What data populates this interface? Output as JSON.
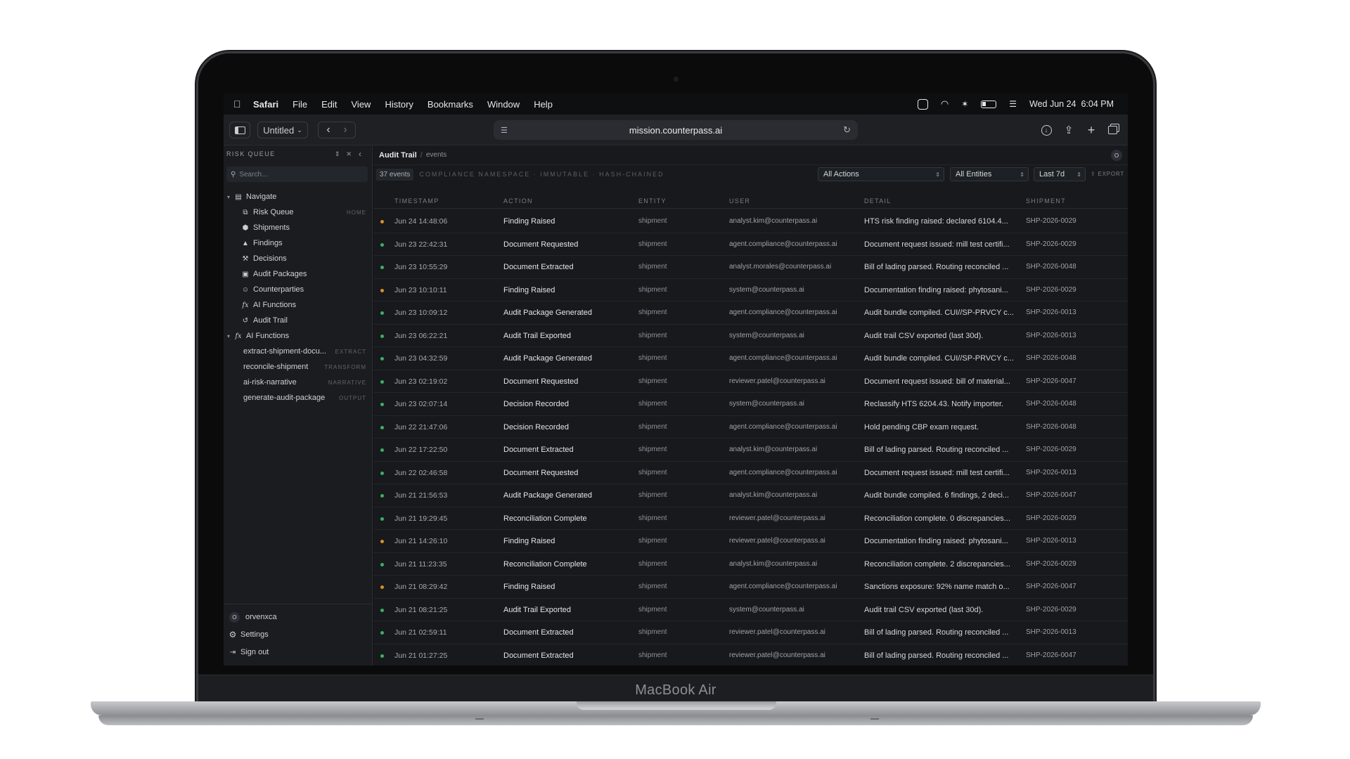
{
  "device": {
    "label": "MacBook Air"
  },
  "menubar": {
    "app": "Safari",
    "items": [
      "File",
      "Edit",
      "View",
      "History",
      "Bookmarks",
      "Window",
      "Help"
    ],
    "clock": "Wed Jun 24  6:04 PM"
  },
  "browser": {
    "tab_group": "Untitled",
    "url": "mission.counterpass.ai"
  },
  "sidebar": {
    "header": "RISK QUEUE",
    "search_placeholder": "Search...",
    "nav_group": "Navigate",
    "nav_items": [
      {
        "label": "Risk Queue",
        "badge": "HOME",
        "icon": "queue-icon"
      },
      {
        "label": "Shipments",
        "badge": "",
        "icon": "package-icon"
      },
      {
        "label": "Findings",
        "badge": "",
        "icon": "warning-icon"
      },
      {
        "label": "Decisions",
        "badge": "",
        "icon": "gavel-icon"
      },
      {
        "label": "Audit Packages",
        "badge": "",
        "icon": "archive-icon"
      },
      {
        "label": "Counterparties",
        "badge": "",
        "icon": "people-icon"
      },
      {
        "label": "AI Functions",
        "badge": "",
        "icon": "function-icon"
      },
      {
        "label": "Audit Trail",
        "badge": "",
        "icon": "history-icon"
      }
    ],
    "fn_group": "AI Functions",
    "fn_items": [
      {
        "label": "extract-shipment-docu...",
        "badge": "EXTRACT"
      },
      {
        "label": "reconcile-shipment",
        "badge": "TRANSFORM"
      },
      {
        "label": "ai-risk-narrative",
        "badge": "NARRATIVE"
      },
      {
        "label": "generate-audit-package",
        "badge": "OUTPUT"
      }
    ],
    "user_initial": "O",
    "user_name": "orvenxca",
    "settings": "Settings",
    "sign_out": "Sign out"
  },
  "header": {
    "title": "Audit Trail",
    "sep": "/",
    "sub": "events",
    "avatar": "O"
  },
  "filters": {
    "count": "37 events",
    "namespace": "COMPLIANCE NAMESPACE · IMMUTABLE · HASH-CHAINED",
    "actions": "All Actions",
    "entities": "All Entities",
    "range": "Last 7d",
    "export": "EXPORT"
  },
  "table": {
    "columns": [
      "TIMESTAMP",
      "ACTION",
      "ENTITY",
      "USER",
      "DETAIL",
      "SHIPMENT"
    ],
    "colors": {
      "warn": "#d8902a",
      "ok": "#3fae63"
    },
    "rows": [
      {
        "status": "warn",
        "ts": "Jun 24 14:48:06",
        "action": "Finding Raised",
        "entity": "shipment",
        "user": "analyst.kim@counterpass.ai",
        "detail": "HTS risk finding raised: declared 6104.4...",
        "shipment": "SHP-2026-0029"
      },
      {
        "status": "ok",
        "ts": "Jun 23 22:42:31",
        "action": "Document Requested",
        "entity": "shipment",
        "user": "agent.compliance@counterpass.ai",
        "detail": "Document request issued: mill test certifi...",
        "shipment": "SHP-2026-0029"
      },
      {
        "status": "ok",
        "ts": "Jun 23 10:55:29",
        "action": "Document Extracted",
        "entity": "shipment",
        "user": "analyst.morales@counterpass.ai",
        "detail": "Bill of lading parsed. Routing reconciled ...",
        "shipment": "SHP-2026-0048"
      },
      {
        "status": "warn",
        "ts": "Jun 23 10:10:11",
        "action": "Finding Raised",
        "entity": "shipment",
        "user": "system@counterpass.ai",
        "detail": "Documentation finding raised: phytosani...",
        "shipment": "SHP-2026-0029"
      },
      {
        "status": "ok",
        "ts": "Jun 23 10:09:12",
        "action": "Audit Package Generated",
        "entity": "shipment",
        "user": "agent.compliance@counterpass.ai",
        "detail": "Audit bundle compiled. CUI//SP-PRVCY c...",
        "shipment": "SHP-2026-0013"
      },
      {
        "status": "ok",
        "ts": "Jun 23 06:22:21",
        "action": "Audit Trail Exported",
        "entity": "shipment",
        "user": "system@counterpass.ai",
        "detail": "Audit trail CSV exported (last 30d).",
        "shipment": "SHP-2026-0013"
      },
      {
        "status": "ok",
        "ts": "Jun 23 04:32:59",
        "action": "Audit Package Generated",
        "entity": "shipment",
        "user": "agent.compliance@counterpass.ai",
        "detail": "Audit bundle compiled. CUI//SP-PRVCY c...",
        "shipment": "SHP-2026-0048"
      },
      {
        "status": "ok",
        "ts": "Jun 23 02:19:02",
        "action": "Document Requested",
        "entity": "shipment",
        "user": "reviewer.patel@counterpass.ai",
        "detail": "Document request issued: bill of material...",
        "shipment": "SHP-2026-0047"
      },
      {
        "status": "ok",
        "ts": "Jun 23 02:07:14",
        "action": "Decision Recorded",
        "entity": "shipment",
        "user": "system@counterpass.ai",
        "detail": "Reclassify HTS 6204.43. Notify importer.",
        "shipment": "SHP-2026-0048"
      },
      {
        "status": "ok",
        "ts": "Jun 22 21:47:06",
        "action": "Decision Recorded",
        "entity": "shipment",
        "user": "agent.compliance@counterpass.ai",
        "detail": "Hold pending CBP exam request.",
        "shipment": "SHP-2026-0048"
      },
      {
        "status": "ok",
        "ts": "Jun 22 17:22:50",
        "action": "Document Extracted",
        "entity": "shipment",
        "user": "analyst.kim@counterpass.ai",
        "detail": "Bill of lading parsed. Routing reconciled ...",
        "shipment": "SHP-2026-0029"
      },
      {
        "status": "ok",
        "ts": "Jun 22 02:46:58",
        "action": "Document Requested",
        "entity": "shipment",
        "user": "agent.compliance@counterpass.ai",
        "detail": "Document request issued: mill test certifi...",
        "shipment": "SHP-2026-0013"
      },
      {
        "status": "ok",
        "ts": "Jun 21 21:56:53",
        "action": "Audit Package Generated",
        "entity": "shipment",
        "user": "analyst.kim@counterpass.ai",
        "detail": "Audit bundle compiled. 6 findings, 2 deci...",
        "shipment": "SHP-2026-0047"
      },
      {
        "status": "ok",
        "ts": "Jun 21 19:29:45",
        "action": "Reconciliation Complete",
        "entity": "shipment",
        "user": "reviewer.patel@counterpass.ai",
        "detail": "Reconciliation complete. 0 discrepancies...",
        "shipment": "SHP-2026-0029"
      },
      {
        "status": "warn",
        "ts": "Jun 21 14:26:10",
        "action": "Finding Raised",
        "entity": "shipment",
        "user": "reviewer.patel@counterpass.ai",
        "detail": "Documentation finding raised: phytosani...",
        "shipment": "SHP-2026-0013"
      },
      {
        "status": "ok",
        "ts": "Jun 21 11:23:35",
        "action": "Reconciliation Complete",
        "entity": "shipment",
        "user": "analyst.kim@counterpass.ai",
        "detail": "Reconciliation complete. 2 discrepancies...",
        "shipment": "SHP-2026-0029"
      },
      {
        "status": "warn",
        "ts": "Jun 21 08:29:42",
        "action": "Finding Raised",
        "entity": "shipment",
        "user": "agent.compliance@counterpass.ai",
        "detail": "Sanctions exposure: 92% name match o...",
        "shipment": "SHP-2026-0047"
      },
      {
        "status": "ok",
        "ts": "Jun 21 08:21:25",
        "action": "Audit Trail Exported",
        "entity": "shipment",
        "user": "system@counterpass.ai",
        "detail": "Audit trail CSV exported (last 30d).",
        "shipment": "SHP-2026-0029"
      },
      {
        "status": "ok",
        "ts": "Jun 21 02:59:11",
        "action": "Document Extracted",
        "entity": "shipment",
        "user": "reviewer.patel@counterpass.ai",
        "detail": "Bill of lading parsed. Routing reconciled ...",
        "shipment": "SHP-2026-0013"
      },
      {
        "status": "ok",
        "ts": "Jun 21 01:27:25",
        "action": "Document Extracted",
        "entity": "shipment",
        "user": "reviewer.patel@counterpass.ai",
        "detail": "Bill of lading parsed. Routing reconciled ...",
        "shipment": "SHP-2026-0047"
      }
    ]
  }
}
